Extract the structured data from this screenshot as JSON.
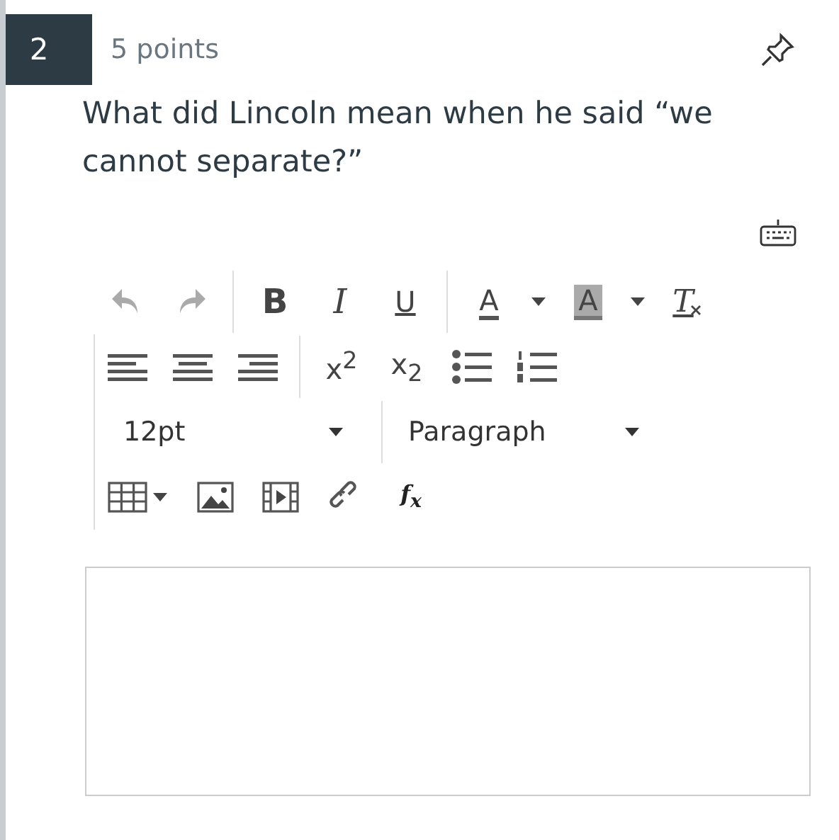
{
  "question": {
    "number": "2",
    "points": "5 points",
    "text": "What did Lincoln mean when he said “we cannot separate?”"
  },
  "toolbar_rows": [
    [
      {
        "kind": "undo",
        "disabled": true
      },
      {
        "kind": "redo",
        "disabled": true
      },
      {
        "kind": "sep"
      },
      {
        "kind": "bold",
        "label": "B"
      },
      {
        "kind": "italic",
        "label": "I"
      },
      {
        "kind": "underline",
        "label": "U"
      },
      {
        "kind": "sep"
      },
      {
        "kind": "forecolor",
        "label": "A"
      },
      {
        "kind": "caret"
      },
      {
        "kind": "backcolor",
        "label": "A"
      },
      {
        "kind": "caret"
      },
      {
        "kind": "clearformat",
        "label": "T"
      }
    ],
    [
      {
        "kind": "align-left"
      },
      {
        "kind": "align-center"
      },
      {
        "kind": "align-right"
      },
      {
        "kind": "sep"
      },
      {
        "kind": "script",
        "label": "x$^{2}$"
      },
      {
        "kind": "script",
        "label": "x$_{2}$"
      },
      {
        "kind": "bullets"
      },
      {
        "kind": "numbers"
      }
    ],
    [
      {
        "kind": "select",
        "label": "12pt"
      },
      {
        "kind": "sep"
      },
      {
        "kind": "select",
        "label": "Paragraph"
      }
    ],
    [
      {
        "kind": "table"
      },
      {
        "kind": "image"
      },
      {
        "kind": "video"
      },
      {
        "kind": "link"
      },
      {
        "kind": "formula",
        "label": "f$_{x}$"
      }
    ]
  ]
}
